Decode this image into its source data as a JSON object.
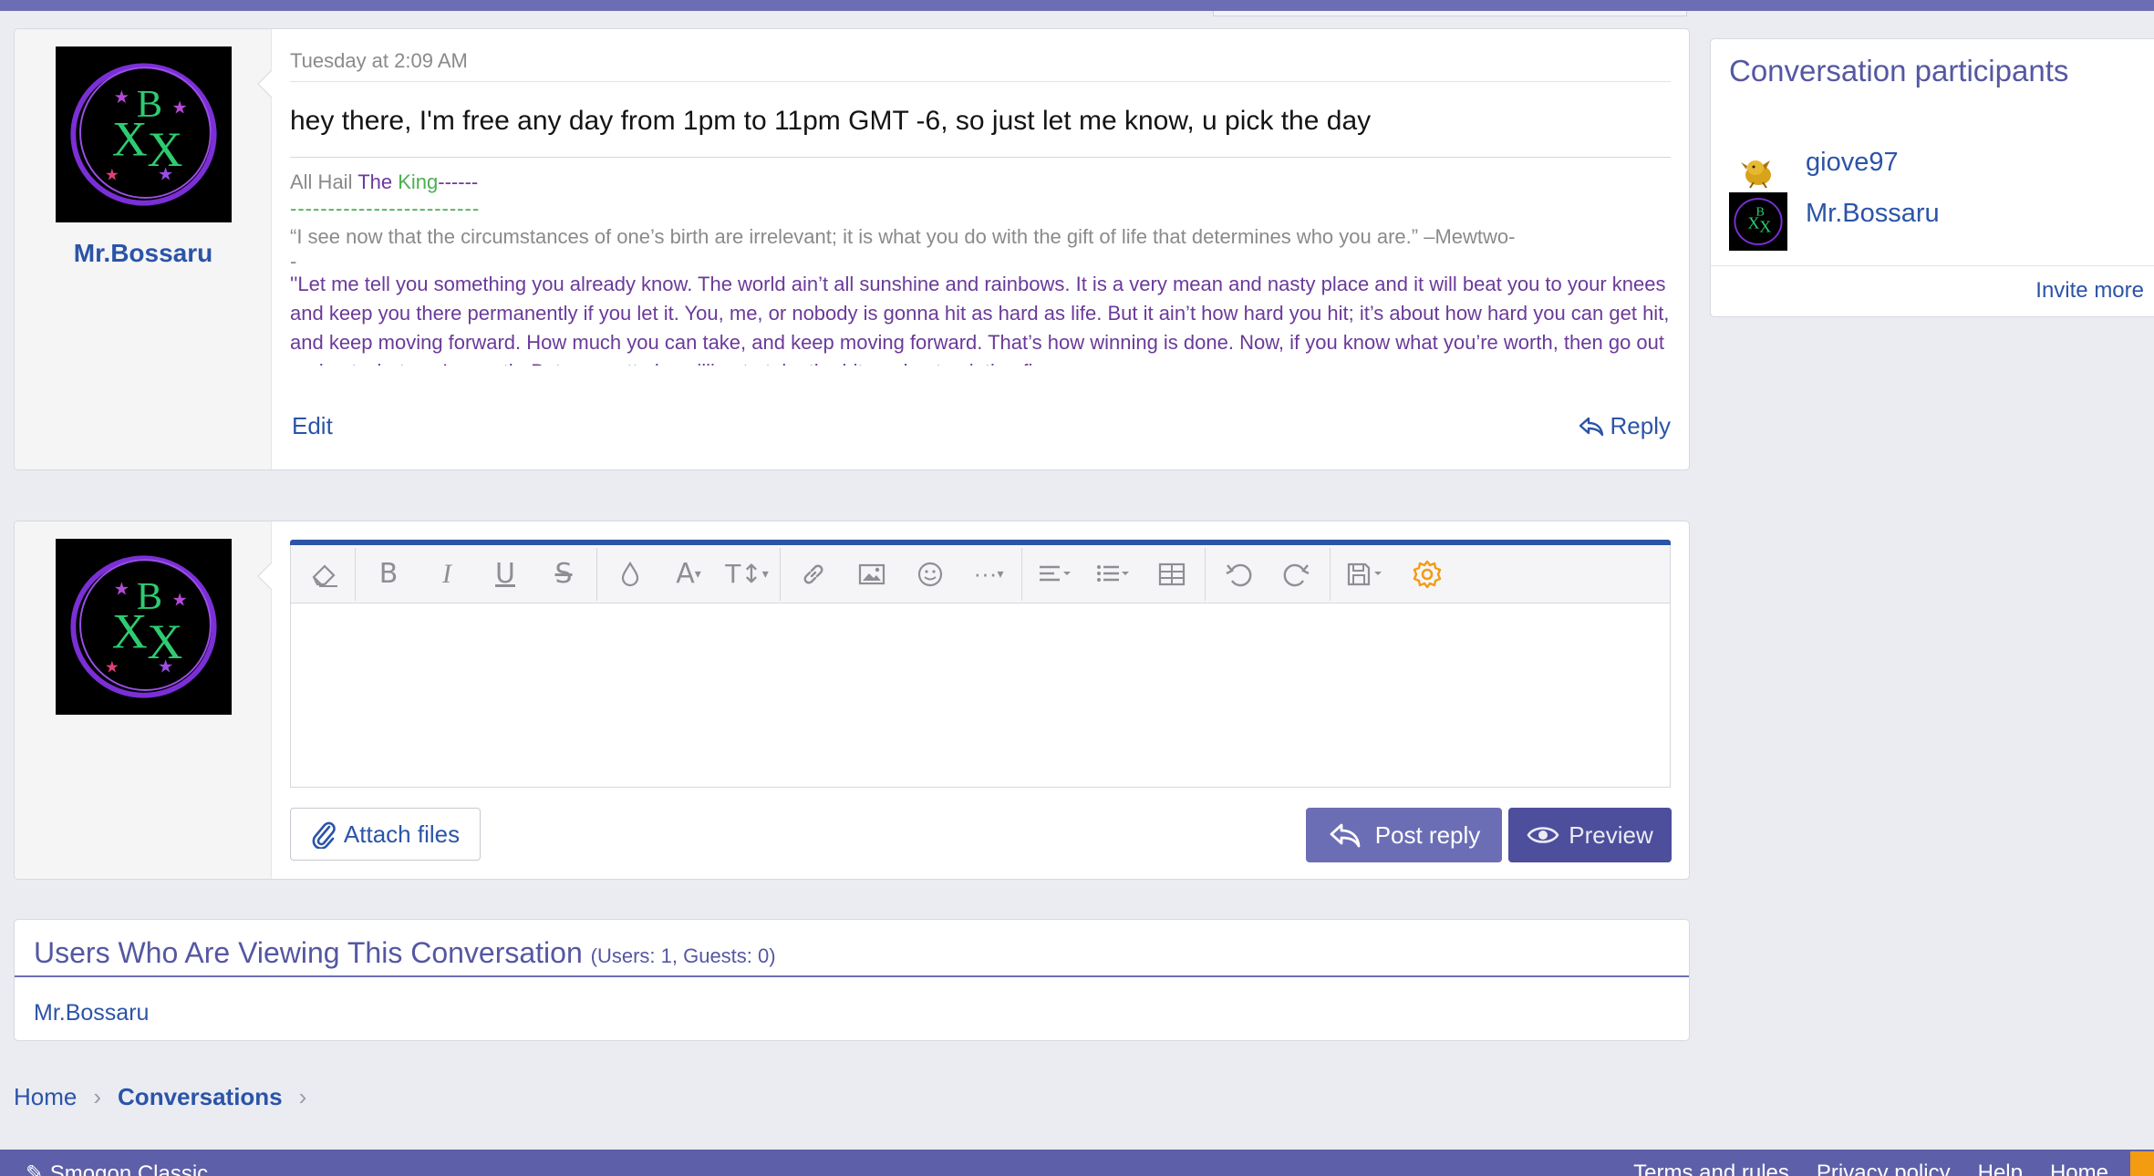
{
  "message": {
    "username": "Mr.Bossaru",
    "date": "Tuesday at 2:09 AM",
    "text": "hey there, I'm free any day from 1pm to 11pm GMT -6, so just let me know, u pick the day",
    "signature": {
      "line1_a": "All Hail ",
      "line1_b": "The ",
      "line1_c": "King",
      "line1_d": "------",
      "line2": "-------------------------",
      "quote1": "“I see now that the circumstances of one’s birth are irrelevant; it is what you do with the gift of life that determines who you are.” –Mewtwo-",
      "quote1_tail": "-",
      "quote2": "''Let me tell you something you already know. The world ain’t all sunshine and rainbows. It is a very mean and nasty place and it will beat you to your knees and keep you there permanently if you let it. You, me, or nobody is gonna hit as hard as life. But it ain’t how hard you hit; it’s about how hard you can get hit, and keep moving forward. How much you can take, and keep moving forward. That’s how winning is done. Now, if you know what you’re worth, then go out and get what you’re worth. But you gotta be willing to take the hit, and not pointing fingers"
    },
    "edit_label": "Edit",
    "reply_label": "Reply"
  },
  "reply_form": {
    "attach_label": "Attach files",
    "post_reply_label": "Post reply",
    "preview_label": "Preview",
    "toolbar_icons": [
      "eraser-icon",
      "bold-icon",
      "italic-icon",
      "underline-icon",
      "strikethrough-icon",
      "color-drop-icon",
      "font-family-icon",
      "font-size-icon",
      "link-icon",
      "image-icon",
      "emoji-icon",
      "more-icon",
      "align-icon",
      "list-icon",
      "table-icon",
      "undo-icon",
      "redo-icon",
      "save-draft-icon",
      "settings-gear-icon"
    ]
  },
  "viewing": {
    "title": "Users Who Are Viewing This Conversation",
    "counts": "(Users: 1, Guests: 0)",
    "user": "Mr.Bossaru"
  },
  "breadcrumb": {
    "home": "Home",
    "conversations": "Conversations"
  },
  "footer": {
    "style": "Smogon Classic",
    "links": [
      "Terms and rules",
      "Privacy policy",
      "Help",
      "Home"
    ]
  },
  "sidebar": {
    "title": "Conversation participants",
    "participants": [
      "giove97",
      "Mr.Bossaru"
    ],
    "invite_label": "Invite more"
  },
  "colors": {
    "accent": "#6c6eb5",
    "link": "#2b54a8",
    "button_dark": "#4d4e9c",
    "gear": "#f39c12"
  }
}
